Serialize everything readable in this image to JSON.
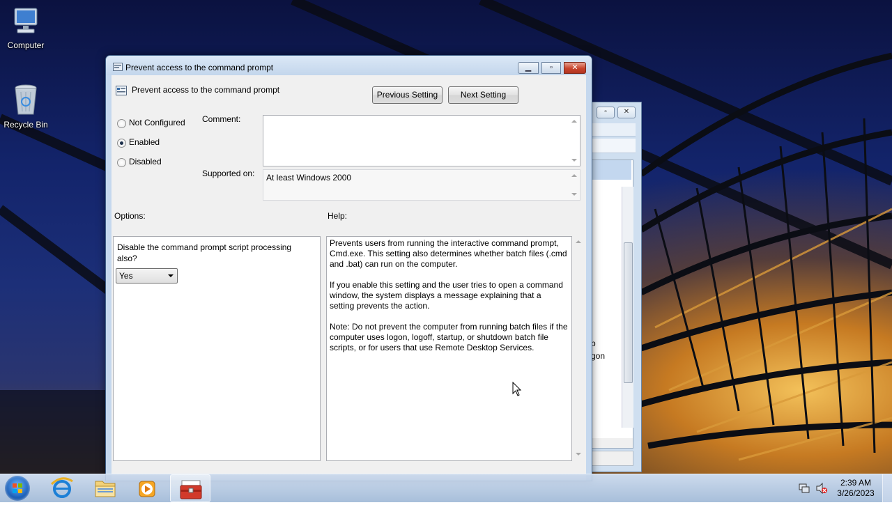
{
  "desktop": {
    "icons": [
      {
        "label": "Computer",
        "icon": "computer-icon"
      },
      {
        "label": "Recycle Bin",
        "icon": "recycle-bin-icon"
      }
    ]
  },
  "background_window": {
    "fragments": [
      "p",
      "gon"
    ]
  },
  "dialog": {
    "title": "Prevent access to the command prompt",
    "policy_name": "Prevent access to the command prompt",
    "previous_setting_label": "Previous Setting",
    "next_setting_label": "Next Setting",
    "radio_options": [
      {
        "label": "Not Configured",
        "selected": false
      },
      {
        "label": "Enabled",
        "selected": true
      },
      {
        "label": "Disabled",
        "selected": false
      }
    ],
    "comment_label": "Comment:",
    "comment_value": "",
    "supported_on_label": "Supported on:",
    "supported_on_value": "At least Windows 2000",
    "options_label": "Options:",
    "help_label": "Help:",
    "option_question": "Disable the command prompt script processing also?",
    "option_selected": "Yes",
    "help_paragraphs": [
      "Prevents users from running the interactive command prompt, Cmd.exe. This setting also determines whether batch files (.cmd and .bat) can run on the computer.",
      "If you enable this setting and the user tries to open a command window, the system displays a message explaining that a setting prevents the action.",
      "Note: Do not prevent the computer from running batch files if the computer uses logon, logoff, startup, or shutdown batch file scripts, or for users that use Remote Desktop Services."
    ]
  },
  "taskbar": {
    "items": [
      {
        "name": "internet-explorer",
        "icon": "internet-explorer-icon"
      },
      {
        "name": "windows-explorer",
        "icon": "folder-icon"
      },
      {
        "name": "media-player",
        "icon": "media-player-icon"
      },
      {
        "name": "group-policy-editor",
        "icon": "toolbox-icon",
        "active": true
      }
    ],
    "clock_time": "2:39 AM",
    "clock_date": "3/26/2023"
  },
  "colors": {
    "title_bar": "#c5d8ee",
    "close_button": "#c8442d",
    "client_bg": "#f0f0f0"
  }
}
